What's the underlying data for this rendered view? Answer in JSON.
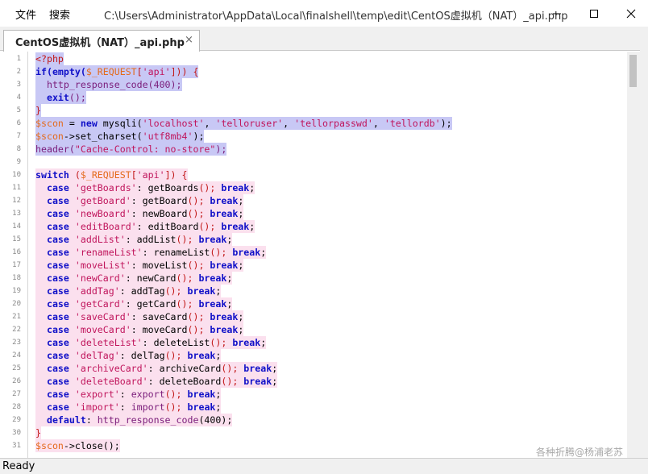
{
  "menu": {
    "file": "文件",
    "search": "搜索"
  },
  "window": {
    "title": "C:\\Users\\Administrator\\AppData\\Local\\finalshell\\temp\\edit\\CentOS虚拟机（NAT）_api.php",
    "icons": {
      "minimize": "minimize-icon",
      "maximize": "maximize-icon",
      "close": "close-icon"
    }
  },
  "tab": {
    "label": "CentOS虚拟机（NAT）_api.php",
    "close_glyph": "×"
  },
  "colors": {
    "keyword": "#1010c8",
    "variable": "#e46a1c",
    "string": "#c0155c",
    "php_tag": "#c21818",
    "function": "#7a1c7a",
    "highlight_php_block": "#c8c8f5",
    "highlight_switch_block": "#fbe0ee"
  },
  "editor": {
    "lines": [
      {
        "n": "1",
        "hl": "blue",
        "tokens": [
          {
            "t": "<?php",
            "c": "tag"
          }
        ]
      },
      {
        "n": "2",
        "hl": "blue",
        "tokens": [
          {
            "t": "if(",
            "c": "kw"
          },
          {
            "t": "empty(",
            "c": "kw"
          },
          {
            "t": "$_REQUEST",
            "c": "var"
          },
          {
            "t": "[",
            "c": "tag"
          },
          {
            "t": "'api'",
            "c": "str"
          },
          {
            "t": "])) {",
            "c": "tag"
          }
        ]
      },
      {
        "n": "3",
        "hl": "blue",
        "tokens": [
          {
            "t": "  http_response_code",
            "c": "fn"
          },
          {
            "t": "(400);",
            "c": "fn"
          }
        ]
      },
      {
        "n": "4",
        "hl": "blue",
        "tokens": [
          {
            "t": "  exit",
            "c": "kw"
          },
          {
            "t": "();",
            "c": "fn"
          }
        ]
      },
      {
        "n": "5",
        "hl": "blue",
        "tokens": [
          {
            "t": "}",
            "c": "tag"
          }
        ]
      },
      {
        "n": "6",
        "hl": "blue",
        "tokens": [
          {
            "t": "$scon",
            "c": "var"
          },
          {
            "t": " = ",
            "c": "txt"
          },
          {
            "t": "new",
            "c": "kw"
          },
          {
            "t": " mysqli(",
            "c": "txt"
          },
          {
            "t": "'localhost'",
            "c": "str"
          },
          {
            "t": ", ",
            "c": "txt"
          },
          {
            "t": "'telloruser'",
            "c": "str"
          },
          {
            "t": ", ",
            "c": "txt"
          },
          {
            "t": "'tellorpasswd'",
            "c": "str"
          },
          {
            "t": ", ",
            "c": "txt"
          },
          {
            "t": "'tellordb'",
            "c": "str"
          },
          {
            "t": ");",
            "c": "txt"
          }
        ]
      },
      {
        "n": "7",
        "hl": "blue",
        "tokens": [
          {
            "t": "$scon",
            "c": "var"
          },
          {
            "t": "->set_charset(",
            "c": "txt"
          },
          {
            "t": "'utf8mb4'",
            "c": "str"
          },
          {
            "t": ");",
            "c": "txt"
          }
        ]
      },
      {
        "n": "8",
        "hl": "blue",
        "tokens": [
          {
            "t": "header(",
            "c": "fn"
          },
          {
            "t": "\"Cache-Control: no-store\"",
            "c": "str"
          },
          {
            "t": ");",
            "c": "fn"
          }
        ]
      },
      {
        "n": "9",
        "hl": "",
        "tokens": []
      },
      {
        "n": "10",
        "hl": "pink",
        "tokens": [
          {
            "t": "switch",
            "c": "kw"
          },
          {
            "t": " (",
            "c": "tag"
          },
          {
            "t": "$_REQUEST",
            "c": "var"
          },
          {
            "t": "[",
            "c": "tag"
          },
          {
            "t": "'api'",
            "c": "str"
          },
          {
            "t": "]) {",
            "c": "tag"
          }
        ]
      },
      {
        "n": "11",
        "hl": "pink",
        "tokens": [
          {
            "t": "  case ",
            "c": "kw"
          },
          {
            "t": "'getBoards'",
            "c": "str"
          },
          {
            "t": ": getBoards",
            "c": "txt"
          },
          {
            "t": "(); ",
            "c": "tag"
          },
          {
            "t": "break",
            "c": "kw"
          },
          {
            "t": ";",
            "c": "txt"
          }
        ]
      },
      {
        "n": "12",
        "hl": "pink",
        "tokens": [
          {
            "t": "  case ",
            "c": "kw"
          },
          {
            "t": "'getBoard'",
            "c": "str"
          },
          {
            "t": ": getBoard",
            "c": "txt"
          },
          {
            "t": "(); ",
            "c": "tag"
          },
          {
            "t": "break",
            "c": "kw"
          },
          {
            "t": ";",
            "c": "txt"
          }
        ]
      },
      {
        "n": "13",
        "hl": "pink",
        "tokens": [
          {
            "t": "  case ",
            "c": "kw"
          },
          {
            "t": "'newBoard'",
            "c": "str"
          },
          {
            "t": ": newBoard",
            "c": "txt"
          },
          {
            "t": "(); ",
            "c": "tag"
          },
          {
            "t": "break",
            "c": "kw"
          },
          {
            "t": ";",
            "c": "txt"
          }
        ]
      },
      {
        "n": "14",
        "hl": "pink",
        "tokens": [
          {
            "t": "  case ",
            "c": "kw"
          },
          {
            "t": "'editBoard'",
            "c": "str"
          },
          {
            "t": ": editBoard",
            "c": "txt"
          },
          {
            "t": "(); ",
            "c": "tag"
          },
          {
            "t": "break",
            "c": "kw"
          },
          {
            "t": ";",
            "c": "txt"
          }
        ]
      },
      {
        "n": "15",
        "hl": "pink",
        "tokens": [
          {
            "t": "  case ",
            "c": "kw"
          },
          {
            "t": "'addList'",
            "c": "str"
          },
          {
            "t": ": addList",
            "c": "txt"
          },
          {
            "t": "(); ",
            "c": "tag"
          },
          {
            "t": "break",
            "c": "kw"
          },
          {
            "t": ";",
            "c": "txt"
          }
        ]
      },
      {
        "n": "16",
        "hl": "pink",
        "tokens": [
          {
            "t": "  case ",
            "c": "kw"
          },
          {
            "t": "'renameList'",
            "c": "str"
          },
          {
            "t": ": renameList",
            "c": "txt"
          },
          {
            "t": "(); ",
            "c": "tag"
          },
          {
            "t": "break",
            "c": "kw"
          },
          {
            "t": ";",
            "c": "txt"
          }
        ]
      },
      {
        "n": "17",
        "hl": "pink",
        "tokens": [
          {
            "t": "  case ",
            "c": "kw"
          },
          {
            "t": "'moveList'",
            "c": "str"
          },
          {
            "t": ": moveList",
            "c": "txt"
          },
          {
            "t": "(); ",
            "c": "tag"
          },
          {
            "t": "break",
            "c": "kw"
          },
          {
            "t": ";",
            "c": "txt"
          }
        ]
      },
      {
        "n": "18",
        "hl": "pink",
        "tokens": [
          {
            "t": "  case ",
            "c": "kw"
          },
          {
            "t": "'newCard'",
            "c": "str"
          },
          {
            "t": ": newCard",
            "c": "txt"
          },
          {
            "t": "(); ",
            "c": "tag"
          },
          {
            "t": "break",
            "c": "kw"
          },
          {
            "t": ";",
            "c": "txt"
          }
        ]
      },
      {
        "n": "19",
        "hl": "pink",
        "tokens": [
          {
            "t": "  case ",
            "c": "kw"
          },
          {
            "t": "'addTag'",
            "c": "str"
          },
          {
            "t": ": addTag",
            "c": "txt"
          },
          {
            "t": "(); ",
            "c": "tag"
          },
          {
            "t": "break",
            "c": "kw"
          },
          {
            "t": ";",
            "c": "txt"
          }
        ]
      },
      {
        "n": "20",
        "hl": "pink",
        "tokens": [
          {
            "t": "  case ",
            "c": "kw"
          },
          {
            "t": "'getCard'",
            "c": "str"
          },
          {
            "t": ": getCard",
            "c": "txt"
          },
          {
            "t": "(); ",
            "c": "tag"
          },
          {
            "t": "break",
            "c": "kw"
          },
          {
            "t": ";",
            "c": "txt"
          }
        ]
      },
      {
        "n": "21",
        "hl": "pink",
        "tokens": [
          {
            "t": "  case ",
            "c": "kw"
          },
          {
            "t": "'saveCard'",
            "c": "str"
          },
          {
            "t": ": saveCard",
            "c": "txt"
          },
          {
            "t": "(); ",
            "c": "tag"
          },
          {
            "t": "break",
            "c": "kw"
          },
          {
            "t": ";",
            "c": "txt"
          }
        ]
      },
      {
        "n": "22",
        "hl": "pink",
        "tokens": [
          {
            "t": "  case ",
            "c": "kw"
          },
          {
            "t": "'moveCard'",
            "c": "str"
          },
          {
            "t": ": moveCard",
            "c": "txt"
          },
          {
            "t": "(); ",
            "c": "tag"
          },
          {
            "t": "break",
            "c": "kw"
          },
          {
            "t": ";",
            "c": "txt"
          }
        ]
      },
      {
        "n": "23",
        "hl": "pink",
        "tokens": [
          {
            "t": "  case ",
            "c": "kw"
          },
          {
            "t": "'deleteList'",
            "c": "str"
          },
          {
            "t": ": deleteList",
            "c": "txt"
          },
          {
            "t": "(); ",
            "c": "tag"
          },
          {
            "t": "break",
            "c": "kw"
          },
          {
            "t": ";",
            "c": "txt"
          }
        ]
      },
      {
        "n": "24",
        "hl": "pink",
        "tokens": [
          {
            "t": "  case ",
            "c": "kw"
          },
          {
            "t": "'delTag'",
            "c": "str"
          },
          {
            "t": ": delTag",
            "c": "txt"
          },
          {
            "t": "(); ",
            "c": "tag"
          },
          {
            "t": "break",
            "c": "kw"
          },
          {
            "t": ";",
            "c": "txt"
          }
        ]
      },
      {
        "n": "25",
        "hl": "pink",
        "tokens": [
          {
            "t": "  case ",
            "c": "kw"
          },
          {
            "t": "'archiveCard'",
            "c": "str"
          },
          {
            "t": ": archiveCard",
            "c": "txt"
          },
          {
            "t": "(); ",
            "c": "tag"
          },
          {
            "t": "break",
            "c": "kw"
          },
          {
            "t": ";",
            "c": "txt"
          }
        ]
      },
      {
        "n": "26",
        "hl": "pink",
        "tokens": [
          {
            "t": "  case ",
            "c": "kw"
          },
          {
            "t": "'deleteBoard'",
            "c": "str"
          },
          {
            "t": ": deleteBoard",
            "c": "txt"
          },
          {
            "t": "(); ",
            "c": "tag"
          },
          {
            "t": "break",
            "c": "kw"
          },
          {
            "t": ";",
            "c": "txt"
          }
        ]
      },
      {
        "n": "27",
        "hl": "pink",
        "tokens": [
          {
            "t": "  case ",
            "c": "kw"
          },
          {
            "t": "'export'",
            "c": "str"
          },
          {
            "t": ": ",
            "c": "txt"
          },
          {
            "t": "export",
            "c": "fn"
          },
          {
            "t": "(); ",
            "c": "tag"
          },
          {
            "t": "break",
            "c": "kw"
          },
          {
            "t": ";",
            "c": "txt"
          }
        ]
      },
      {
        "n": "28",
        "hl": "pink",
        "tokens": [
          {
            "t": "  case ",
            "c": "kw"
          },
          {
            "t": "'import'",
            "c": "str"
          },
          {
            "t": ": ",
            "c": "txt"
          },
          {
            "t": "import",
            "c": "fn"
          },
          {
            "t": "(); ",
            "c": "tag"
          },
          {
            "t": "break",
            "c": "kw"
          },
          {
            "t": ";",
            "c": "txt"
          }
        ]
      },
      {
        "n": "29",
        "hl": "pink",
        "tokens": [
          {
            "t": "  default",
            "c": "kw"
          },
          {
            "t": ": ",
            "c": "txt"
          },
          {
            "t": "http_response_code",
            "c": "fn"
          },
          {
            "t": "(400);",
            "c": "txt"
          }
        ]
      },
      {
        "n": "30",
        "hl": "pink",
        "tokens": [
          {
            "t": "}",
            "c": "tag"
          }
        ]
      },
      {
        "n": "31",
        "hl": "pink",
        "tokens": [
          {
            "t": "$scon",
            "c": "var"
          },
          {
            "t": "->close();",
            "c": "txt"
          }
        ]
      }
    ]
  },
  "watermark": "各种折腾@杨浦老苏",
  "status": {
    "text": "Ready"
  }
}
